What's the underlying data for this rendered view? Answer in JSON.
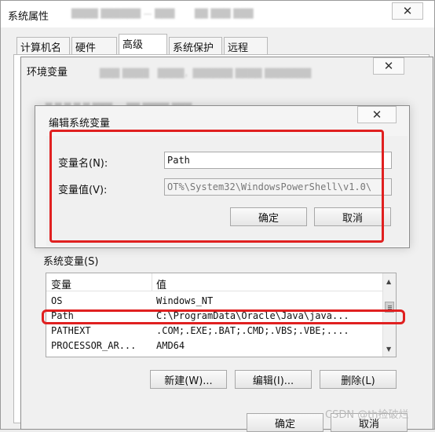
{
  "outer": {
    "title": "系统属性",
    "close_glyph": "✕",
    "tabs": [
      "计算机名",
      "硬件",
      "高级",
      "系统保护",
      "远程"
    ],
    "active_tab": "高级"
  },
  "env": {
    "title": "环境变量",
    "close_glyph": "✕"
  },
  "edit": {
    "title": "编辑系统变量",
    "close_glyph": "✕",
    "name_label": "变量名(N):",
    "value_label": "变量值(V):",
    "name_value": "Path",
    "value_value": "OT%\\System32\\WindowsPowerShell\\v1.0\\",
    "ok_label": "确定",
    "cancel_label": "取消"
  },
  "sysvars": {
    "label": "系统变量(S)",
    "columns": [
      "变量",
      "值"
    ],
    "rows": [
      {
        "name": "OS",
        "value": "Windows_NT"
      },
      {
        "name": "Path",
        "value": "C:\\ProgramData\\Oracle\\Java\\java..."
      },
      {
        "name": "PATHEXT",
        "value": ".COM;.EXE;.BAT;.CMD;.VBS;.VBE;...."
      },
      {
        "name": "PROCESSOR_AR...",
        "value": "AMD64"
      }
    ],
    "new_label": "新建(W)...",
    "edit_label": "编辑(I)...",
    "delete_label": "删除(L)"
  },
  "bottom": {
    "ok_label": "确定",
    "cancel_label": "取消"
  },
  "watermark": "CSDN @th捡破烂",
  "colors": {
    "highlight_box": "#e02020"
  }
}
